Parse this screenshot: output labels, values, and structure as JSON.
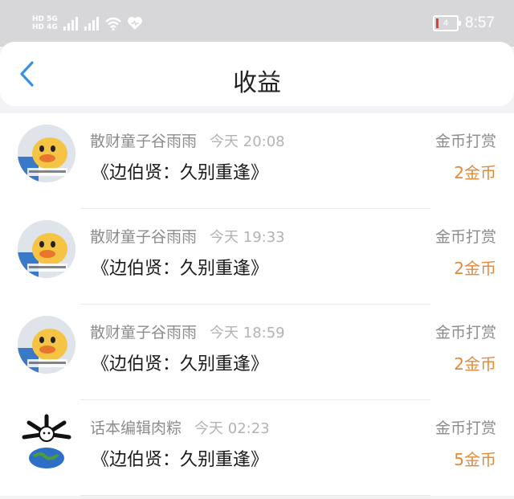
{
  "status_bar": {
    "network_small_top": "HD 5G",
    "network_small_bottom": "HD 4G",
    "battery_level": "4",
    "time": "8:57",
    "icons": [
      "signal-icon",
      "signal-icon",
      "wifi-icon",
      "heart-icon",
      "battery-icon"
    ]
  },
  "header": {
    "title": "收益",
    "back_icon": "chevron-left-icon"
  },
  "colors": {
    "accent_blue": "#3b8fe0",
    "amount_orange": "#e28a3c",
    "status_bar_bg": "#d7d7d9"
  },
  "rewards": [
    {
      "avatar": "duck-avatar",
      "username": "散财童子谷雨雨",
      "time": "今天 20:08",
      "book": "《边伯贤：久别重逢》",
      "reward_type": "金币打赏",
      "amount": "2金币"
    },
    {
      "avatar": "duck-avatar",
      "username": "散财童子谷雨雨",
      "time": "今天 19:33",
      "book": "《边伯贤：久别重逢》",
      "reward_type": "金币打赏",
      "amount": "2金币"
    },
    {
      "avatar": "duck-avatar",
      "username": "散财童子谷雨雨",
      "time": "今天 18:59",
      "book": "《边伯贤：久别重逢》",
      "reward_type": "金币打赏",
      "amount": "2金币"
    },
    {
      "avatar": "planet-avatar",
      "username": "话本编辑肉粽",
      "time": "今天 02:23",
      "book": "《边伯贤：久别重逢》",
      "reward_type": "金币打赏",
      "amount": "5金币"
    }
  ]
}
